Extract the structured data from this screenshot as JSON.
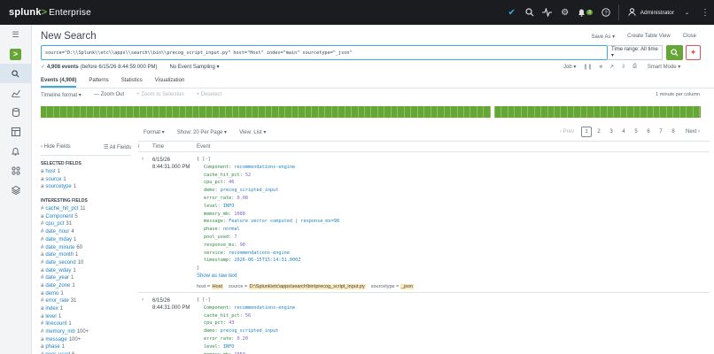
{
  "topbar": {
    "brand": "splunk",
    "brand_gt": ">",
    "product": "Enterprise",
    "badge_count": "3",
    "user": "Administrator",
    "icons": [
      "check-circle-icon",
      "search-icon",
      "activity-icon",
      "gear-icon",
      "bell-icon",
      "help-icon",
      "user-icon",
      "kebab-menu-icon"
    ]
  },
  "sidenav": {
    "items": [
      "menu-icon",
      "app-launcher-icon",
      "search-icon",
      "analytics-icon",
      "datasets-icon",
      "dashboards-icon",
      "alerts-icon",
      "settings-icon",
      "apps-icon"
    ]
  },
  "page": {
    "title": "New Search",
    "save_as": "Save As ▾",
    "create_table_view": "Create Table View",
    "close": "Close"
  },
  "search": {
    "query": "source=\"D:\\\\Splunk\\\\etc\\\\apps\\\\search\\\\bin\\\\precog_script_input.py\" host=\"Host\" index=\"main\" sourcetype=\"_json\"",
    "time_range": "Time range: All time ▾"
  },
  "status": {
    "events_count": "4,908 events",
    "events_range": "(before 6/15/26 8:44:59.000 PM)",
    "sampling": "No Event Sampling ▾",
    "job": "Job ▾",
    "mode": "Smart Mode ▾"
  },
  "tabs": [
    {
      "label": "Events (4,908)",
      "active": true
    },
    {
      "label": "Patterns"
    },
    {
      "label": "Statistics"
    },
    {
      "label": "Visualization"
    }
  ],
  "timeline": {
    "format": "Timeline format ▾",
    "zoom_out": "— Zoom Out",
    "zoom_selection": "+ Zoom to Selection",
    "deselect": "× Deselect",
    "per_column": "1 minute per column"
  },
  "results_toolbar": {
    "format": "Format ▾",
    "per_page": "Show: 20 Per Page ▾",
    "view": "View: List ▾"
  },
  "pager": {
    "prev": "‹ Prev",
    "pages": [
      "1",
      "2",
      "3",
      "4",
      "5",
      "6",
      "7",
      "8"
    ],
    "current": "1",
    "next": "Next ›"
  },
  "fields": {
    "hide": "‹ Hide Fields",
    "all": "☰ All Fields",
    "selected_title": "SELECTED FIELDS",
    "selected": [
      {
        "type": "a",
        "name": "host",
        "count": "1"
      },
      {
        "type": "a",
        "name": "source",
        "count": "1"
      },
      {
        "type": "a",
        "name": "sourcetype",
        "count": "1"
      }
    ],
    "interesting_title": "INTERESTING FIELDS",
    "interesting": [
      {
        "type": "#",
        "name": "cache_hit_pct",
        "count": "11"
      },
      {
        "type": "a",
        "name": "Component",
        "count": "5"
      },
      {
        "type": "#",
        "name": "cpu_pct",
        "count": "31"
      },
      {
        "type": "#",
        "name": "date_hour",
        "count": "4"
      },
      {
        "type": "#",
        "name": "date_mday",
        "count": "1"
      },
      {
        "type": "#",
        "name": "date_minute",
        "count": "60"
      },
      {
        "type": "a",
        "name": "date_month",
        "count": "1"
      },
      {
        "type": "#",
        "name": "date_second",
        "count": "10"
      },
      {
        "type": "a",
        "name": "date_wday",
        "count": "1"
      },
      {
        "type": "#",
        "name": "date_year",
        "count": "1"
      },
      {
        "type": "a",
        "name": "date_zone",
        "count": "1"
      },
      {
        "type": "a",
        "name": "demo",
        "count": "1"
      },
      {
        "type": "#",
        "name": "error_rate",
        "count": "31"
      },
      {
        "type": "a",
        "name": "index",
        "count": "1"
      },
      {
        "type": "a",
        "name": "level",
        "count": "1"
      },
      {
        "type": "#",
        "name": "linecount",
        "count": "1"
      },
      {
        "type": "#",
        "name": "memory_mb",
        "count": "100+"
      },
      {
        "type": "a",
        "name": "message",
        "count": "100+"
      },
      {
        "type": "a",
        "name": "phase",
        "count": "1"
      },
      {
        "type": "#",
        "name": "pool_used",
        "count": "6"
      }
    ]
  },
  "table": {
    "col_time": "Time",
    "col_event": "Event",
    "events": [
      {
        "date": "6/15/26",
        "time": "8:44:31.000 PM",
        "open": "{ [-]",
        "lines": [
          {
            "k": "Component",
            "v": "recommendations-engine",
            "t": "str"
          },
          {
            "k": "cache_hit_pct",
            "v": "52",
            "t": "num"
          },
          {
            "k": "cpu_pct",
            "v": "46",
            "t": "num"
          },
          {
            "k": "demo",
            "v": "precog_scripted_input",
            "t": "str"
          },
          {
            "k": "error_rate",
            "v": "0.08",
            "t": "num"
          },
          {
            "k": "level",
            "v": "INFO",
            "t": "str"
          },
          {
            "k": "memory_mb",
            "v": "1088",
            "t": "num"
          },
          {
            "k": "message",
            "v": "Feature vector computed | response_ms=98",
            "t": "str"
          },
          {
            "k": "phase",
            "v": "normal",
            "t": "str"
          },
          {
            "k": "pool_used",
            "v": "7",
            "t": "num"
          },
          {
            "k": "response_ms",
            "v": "98",
            "t": "num"
          },
          {
            "k": "service",
            "v": "recommendations-engine",
            "t": "str"
          },
          {
            "k": "timestamp",
            "v": "2026-06-15T15:14:31.000Z",
            "t": "str"
          }
        ],
        "close": "}",
        "raw": "Show as raw text",
        "host_label": "host =",
        "host": "Host",
        "source_label": "source =",
        "source": "D:\\Splunk\\etc\\apps\\search\\bin\\precog_script_input.py",
        "st_label": "sourcetype =",
        "sourcetype": "_json"
      },
      {
        "date": "6/15/26",
        "time": "8:44:31.000 PM",
        "open": "{ [-]",
        "lines": [
          {
            "k": "Component",
            "v": "recommendations-engine",
            "t": "str"
          },
          {
            "k": "cache_hit_pct",
            "v": "56",
            "t": "num"
          },
          {
            "k": "cpu_pct",
            "v": "43",
            "t": "num"
          },
          {
            "k": "demo",
            "v": "precog_scripted_input",
            "t": "str"
          },
          {
            "k": "error_rate",
            "v": "0.20",
            "t": "num"
          },
          {
            "k": "level",
            "v": "INFO",
            "t": "str"
          },
          {
            "k": "memory_mb",
            "v": "1050",
            "t": "num"
          },
          {
            "k": "message",
            "v": "Feature vector computed | response_ms=103",
            "t": "str"
          }
        ]
      }
    ]
  }
}
